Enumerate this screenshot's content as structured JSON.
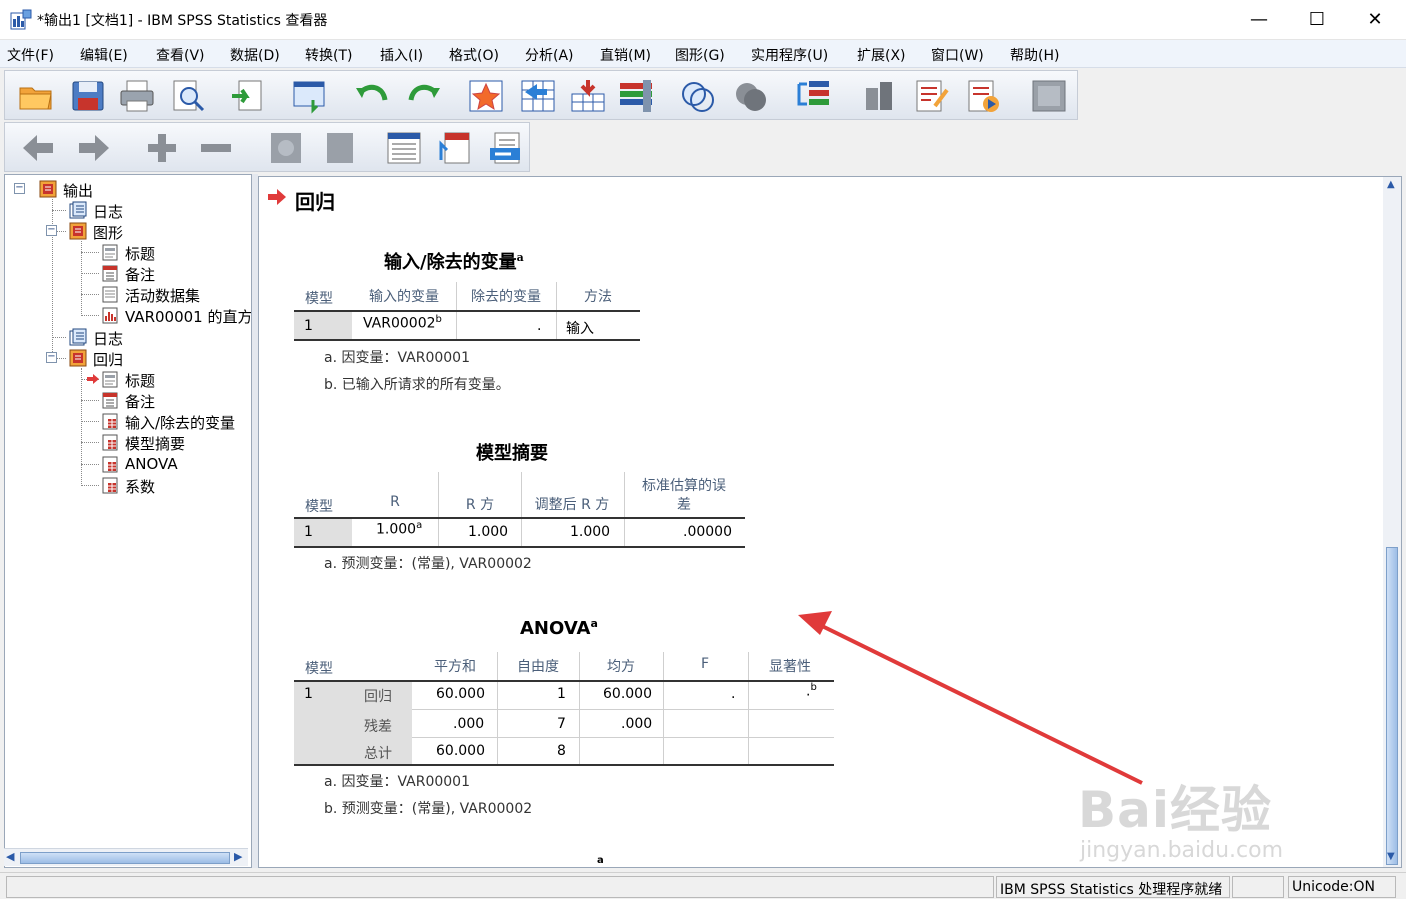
{
  "window": {
    "title": "*输出1 [文档1] - IBM SPSS Statistics 查看器",
    "minimize": "—",
    "maximize": "☐",
    "close": "✕"
  },
  "menu": [
    "文件(F)",
    "编辑(E)",
    "查看(V)",
    "数据(D)",
    "转换(T)",
    "插入(I)",
    "格式(O)",
    "分析(A)",
    "直销(M)",
    "图形(G)",
    "实用程序(U)",
    "扩展(X)",
    "窗口(W)",
    "帮助(H)"
  ],
  "toolbar1": [
    "open-icon",
    "save-icon",
    "print-icon",
    "print-preview-icon",
    "export-icon",
    "recall-dialog-icon",
    "undo-icon",
    "redo-icon",
    "goto-case-icon",
    "goto-variable-icon",
    "insert-cases-icon",
    "variables-icon",
    "circles-venn-icon",
    "circles-gray-icon",
    "split-icon",
    "weight-icon",
    "design-text-icon",
    "run-script-icon",
    "disabled-icon"
  ],
  "toolbar2": [
    "back-icon",
    "forward-icon",
    "expand-icon",
    "collapse-icon",
    "show-icon",
    "hide-icon",
    "insert-heading-icon",
    "insert-title-icon",
    "insert-text-icon"
  ],
  "tree": {
    "root": "输出",
    "log1": "日志",
    "graph": "图形",
    "graph_title": "标题",
    "graph_notes": "备注",
    "graph_dataset": "活动数据集",
    "graph_histogram": "VAR00001 的直方",
    "log2": "日志",
    "regression": "回归",
    "reg_title": "标题",
    "reg_notes": "备注",
    "reg_vars": "输入/除去的变量",
    "reg_summary": "模型摘要",
    "reg_anova": "ANOVA",
    "reg_coeff": "系数"
  },
  "section_title": "回归",
  "table1": {
    "title": "输入/除去的变量",
    "title_sup": "a",
    "headers": [
      "模型",
      "输入的变量",
      "除去的变量",
      "方法"
    ],
    "row": {
      "model": "1",
      "entered": "VAR00002",
      "entered_sup": "b",
      "removed": ".",
      "method": "输入"
    },
    "notes": [
      "a. 因变量：VAR00001",
      "b. 已输入所请求的所有变量。"
    ]
  },
  "table2": {
    "title": "模型摘要",
    "headers": [
      "模型",
      "R",
      "R 方",
      "调整后 R 方",
      "标准估算的误",
      "差"
    ],
    "row": {
      "model": "1",
      "r": "1.000",
      "r_sup": "a",
      "r2": "1.000",
      "adj_r2": "1.000",
      "se": ".00000"
    },
    "notes": [
      "a. 预测变量：(常量), VAR00002"
    ]
  },
  "table3": {
    "title": "ANOVA",
    "title_sup": "a",
    "headers": [
      "模型",
      "平方和",
      "自由度",
      "均方",
      "F",
      "显著性"
    ],
    "model": "1",
    "rows": [
      {
        "label": "回归",
        "ss": "60.000",
        "df": "1",
        "ms": "60.000",
        "f": ".",
        "sig": ".",
        "sig_sup": "b"
      },
      {
        "label": "残差",
        "ss": ".000",
        "df": "7",
        "ms": ".000"
      },
      {
        "label": "总计",
        "ss": "60.000",
        "df": "8"
      }
    ],
    "notes": [
      "a. 因变量：VAR00001",
      "b. 预测变量：(常量), VAR00002"
    ]
  },
  "next_title_sup": "a",
  "watermark": {
    "line1": "Bai经验",
    "line2": "jingyan.baidu.com"
  },
  "status": {
    "processor": "IBM SPSS Statistics 处理程序就绪",
    "unicode": "Unicode:ON"
  },
  "colors": {
    "accent_arrow": "#e03a3a",
    "menu_bg": "#eff4fb",
    "header_text": "#4b5f7a"
  }
}
